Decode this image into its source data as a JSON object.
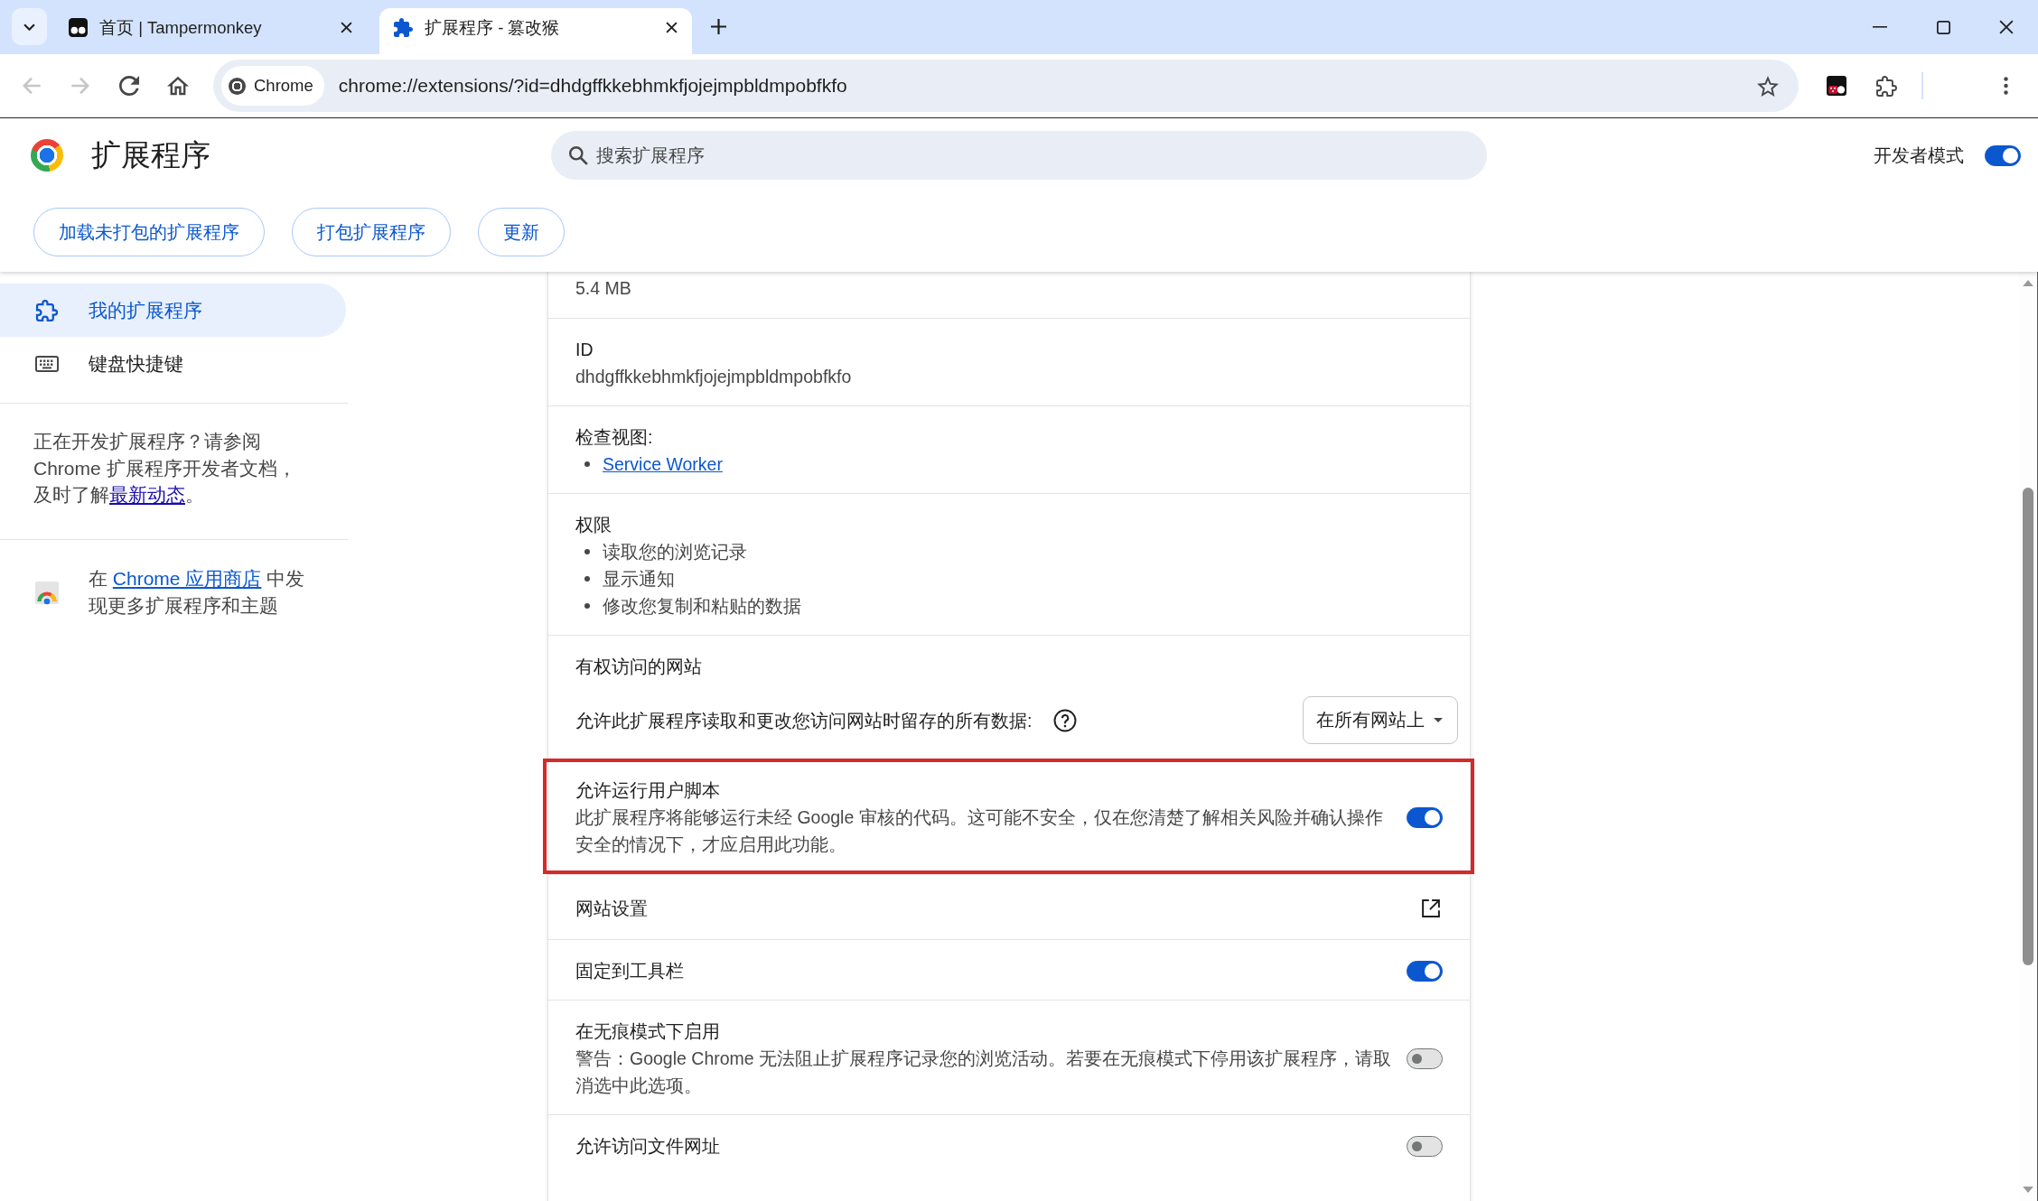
{
  "tab_strip": {
    "tabs": [
      {
        "title": "首页 | Tampermonkey",
        "selected": false
      },
      {
        "title": "扩展程序 - 篡改猴",
        "selected": true
      }
    ]
  },
  "toolbar": {
    "nav_buttons": [
      {
        "kind": "back",
        "disabled": true
      },
      {
        "kind": "forward",
        "disabled": true
      },
      {
        "kind": "reload",
        "disabled": false
      },
      {
        "kind": "home",
        "disabled": false
      }
    ],
    "omnibox": {
      "chip": "Chrome",
      "url": "chrome://extensions/?id=dhdgffkkebhmkfjojejmpbldmpobfkfo"
    }
  },
  "header": {
    "title": "扩展程序",
    "search": {
      "placeholder": "搜索扩展程序"
    },
    "developer_mode": {
      "label": "开发者模式",
      "on": true
    },
    "buttons": [
      "加载未打包的扩展程序",
      "打包扩展程序",
      "更新"
    ]
  },
  "sidebar": {
    "items": [
      {
        "label": "我的扩展程序",
        "selected": true
      },
      {
        "label": "键盘快捷键",
        "selected": false
      }
    ],
    "developer_note": {
      "text": "正在开发扩展程序？请参阅 Chrome 扩展程序开发者文档，及时了解",
      "link": "最新动态",
      "end": "。"
    },
    "store_note": {
      "before": "在 ",
      "link": "Chrome 应用商店",
      "after": " 中发现更多扩展程序和主题"
    }
  },
  "details": {
    "sections": [
      {
        "kind": "info",
        "value": "5.4 MB"
      },
      {
        "kind": "info",
        "label": "ID",
        "value": "dhdgffkkebhmkfjojejmpbldmpobfkfo"
      },
      {
        "kind": "links",
        "label": "检查视图:",
        "links": [
          "Service Worker"
        ]
      },
      {
        "kind": "list",
        "label": "权限",
        "items": [
          "读取您的浏览记录",
          "显示通知",
          "修改您复制和粘贴的数据"
        ]
      },
      {
        "kind": "site_access",
        "label": "有权访问的网站",
        "description": "允许此扩展程序读取和更改您访问网站时留存的所有数据:",
        "dropdown": "在所有网站上"
      },
      {
        "kind": "toggle",
        "label": "允许运行用户脚本",
        "description": "此扩展程序将能够运行未经 Google 审核的代码。这可能不安全，仅在您清楚了解相关风险并确认操作安全的情况下，才应启用此功能。",
        "on": true,
        "highlighted": true
      },
      {
        "kind": "link_row",
        "label": "网站设置"
      },
      {
        "kind": "toggle",
        "label": "固定到工具栏",
        "on": true,
        "highlighted": false
      },
      {
        "kind": "toggle",
        "label": "在无痕模式下启用",
        "description": "警告：Google Chrome 无法阻止扩展程序记录您的浏览活动。若要在无痕模式下停用该扩展程序，请取消选中此选项。",
        "on": false,
        "highlighted": false
      },
      {
        "kind": "toggle",
        "label": "允许访问文件网址",
        "on": false,
        "highlighted": false
      }
    ]
  }
}
